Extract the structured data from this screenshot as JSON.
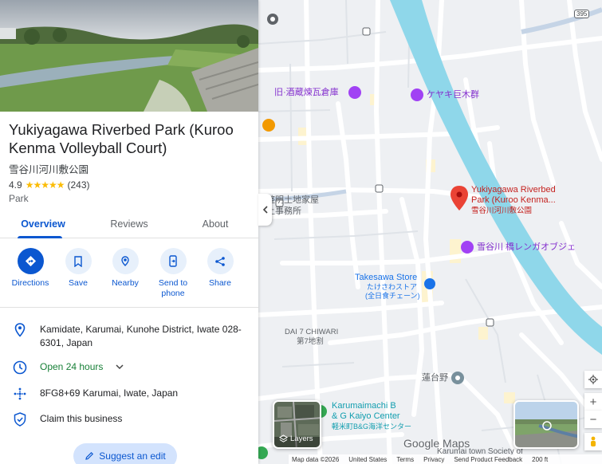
{
  "place": {
    "title": "Yukiyagawa Riverbed Park (Kuroo Kenma Volleyball Court)",
    "subtitle": "雪谷川河川敷公園",
    "rating": "4.9",
    "review_count": "(243)",
    "category": "Park"
  },
  "tabs": [
    {
      "label": "Overview",
      "active": true
    },
    {
      "label": "Reviews",
      "active": false
    },
    {
      "label": "About",
      "active": false
    }
  ],
  "actions": [
    {
      "label": "Directions",
      "icon": "directions-icon"
    },
    {
      "label": "Save",
      "icon": "bookmark-icon"
    },
    {
      "label": "Nearby",
      "icon": "nearby-icon"
    },
    {
      "label": "Send to phone",
      "icon": "send-to-phone-icon"
    },
    {
      "label": "Share",
      "icon": "share-icon"
    }
  ],
  "info": {
    "address": "Kamidate, Karumai, Kunohe District, Iwate 028-6301, Japan",
    "hours": "Open 24 hours",
    "plus_code": "8FG8+69 Karumai, Iwate, Japan",
    "claim": "Claim this business"
  },
  "suggest_edit": "Suggest an edit",
  "map": {
    "labels": {
      "brick_warehouse": "旧·酒蔵煉瓦倉庫",
      "keyaki": "ケヤキ巨木群",
      "land_office_1": "整明土地家屋",
      "land_office_2": "土事務所",
      "pin_title_1": "Yukiyagawa Riverbed",
      "pin_title_2": "Park (Kuroo Kenma...",
      "pin_subtitle": "雪谷川河川敷公園",
      "bridge": "雪谷川 橋レンガオブジェ",
      "store": "Takesawa Store",
      "store_jp_1": "たけさわストア",
      "store_jp_2": "(全日食チェーン)",
      "district_en": "DAI 7 CHIWARI",
      "district_jp": "第7地割",
      "rendaino": "蓮台野",
      "kaiyo_1": "Karumaimachi B",
      "kaiyo_2": "& G Kaiyo Center",
      "kaiyo_jp": "軽米町B&G海洋センター",
      "karumai_town": "Karumai town Society of",
      "route_shield": "395"
    },
    "layers_label": "Layers",
    "google_maps": "Google Maps",
    "attribution": [
      "Map data ©2026",
      "United States",
      "Terms",
      "Privacy",
      "Send Product Feedback",
      "200 ft"
    ],
    "colors": {
      "river": "#8fd7ea",
      "pin": "#ea4335",
      "road": "#ffffff",
      "block": "#eceef0",
      "accent": "#0b57d0"
    }
  }
}
